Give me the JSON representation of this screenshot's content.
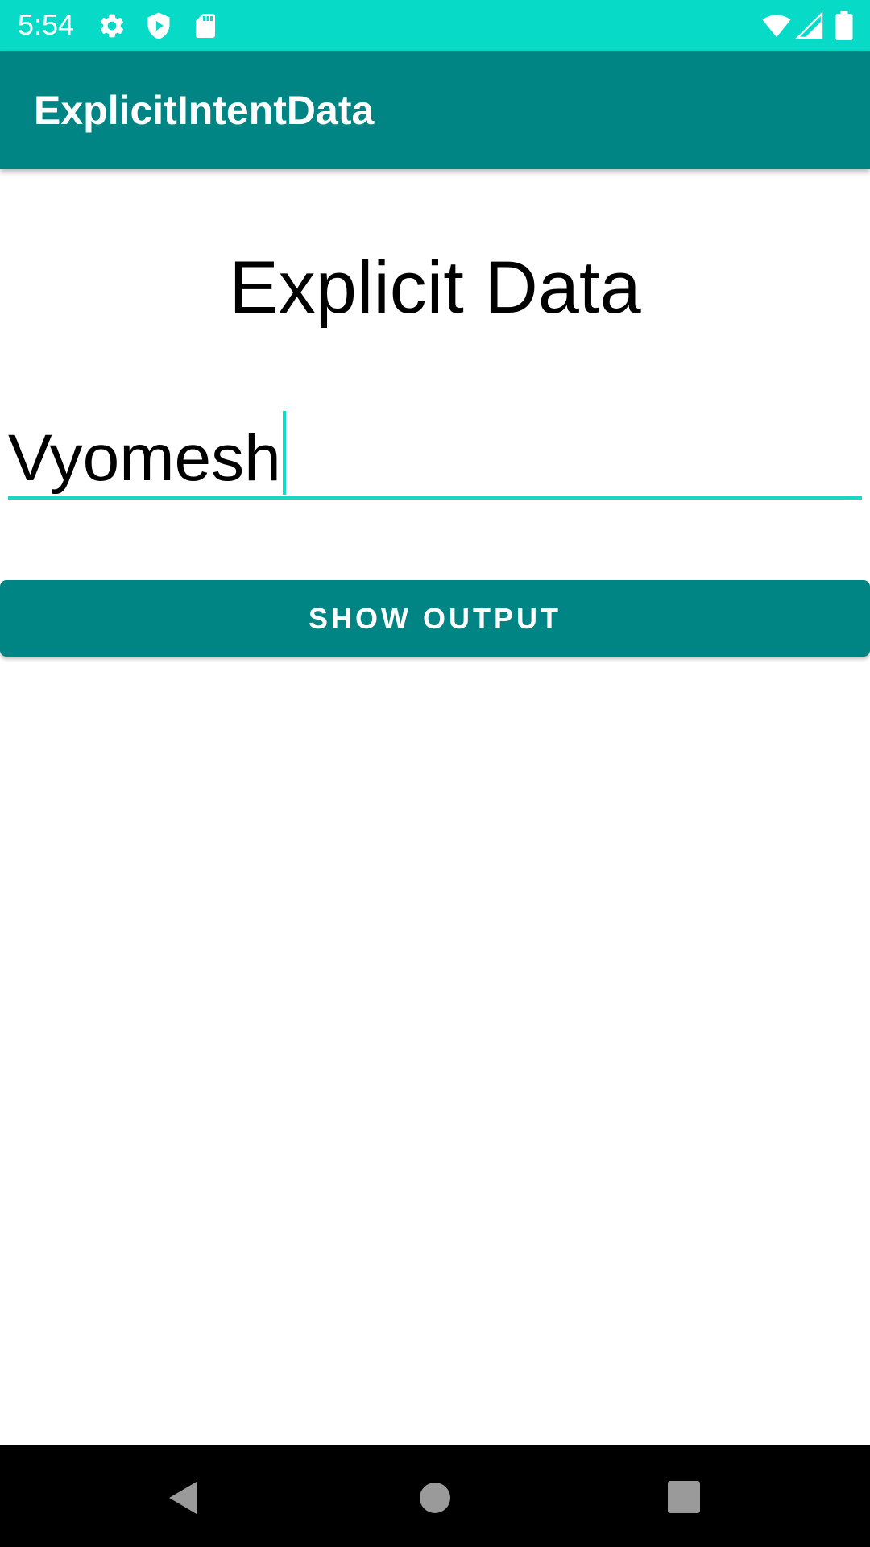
{
  "status_bar": {
    "time": "5:54",
    "background_color": "#07dbc7",
    "left_icons": [
      "settings-gear-icon",
      "play-protect-shield-icon",
      "sd-card-icon"
    ],
    "right_icons": [
      "wifi-icon",
      "cell-signal-icon",
      "battery-icon"
    ]
  },
  "app_bar": {
    "title": "ExplicitIntentData",
    "background_color": "#008584"
  },
  "main": {
    "heading": "Explicit Data",
    "name_field": {
      "value": "Vyomesh",
      "focused": true,
      "accent_color": "#1ad6c4"
    },
    "show_output_button": {
      "label": "SHOW OUTPUT",
      "background_color": "#008584"
    }
  },
  "nav_bar": {
    "icons": [
      "back-triangle-icon",
      "home-circle-icon",
      "recents-square-icon"
    ]
  }
}
